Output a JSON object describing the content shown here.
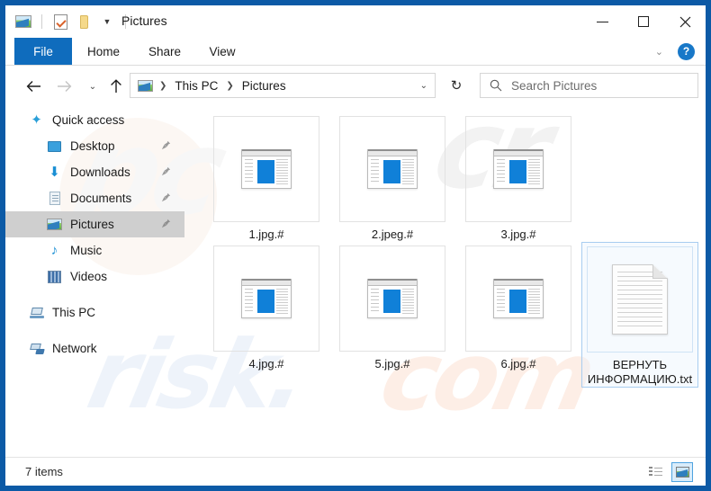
{
  "window": {
    "title": "Pictures",
    "quick_access_toolbar": [
      {
        "name": "picture-folder-icon",
        "label": "Pictures"
      },
      {
        "name": "properties-icon",
        "label": "Properties"
      },
      {
        "name": "new-folder-icon",
        "label": "New folder"
      },
      {
        "name": "customize-chevron-icon",
        "label": "Customize Quick Access Toolbar"
      }
    ],
    "controls": {
      "minimize": "Minimize",
      "maximize": "Maximize",
      "close": "Close"
    }
  },
  "ribbon": {
    "tabs": [
      {
        "label": "File",
        "active": true
      },
      {
        "label": "Home",
        "active": false
      },
      {
        "label": "Share",
        "active": false
      },
      {
        "label": "View",
        "active": false
      }
    ],
    "expand_label": "⌄",
    "help_label": "?"
  },
  "navigation": {
    "back": "←",
    "forward": "→",
    "recent": "⌄",
    "up": "↑",
    "refresh": "↻",
    "breadcrumb": [
      "This PC",
      "Pictures"
    ],
    "breadcrumb_separator": "❯",
    "address_chevron": "⌄"
  },
  "search": {
    "placeholder": "Search Pictures"
  },
  "sidebar": {
    "items": [
      {
        "label": "Quick access",
        "icon": "star-icon",
        "level": 0,
        "pinned": false,
        "selected": false
      },
      {
        "label": "Desktop",
        "icon": "desktop-icon",
        "level": 1,
        "pinned": true,
        "selected": false
      },
      {
        "label": "Downloads",
        "icon": "downloads-icon",
        "level": 1,
        "pinned": true,
        "selected": false
      },
      {
        "label": "Documents",
        "icon": "documents-icon",
        "level": 1,
        "pinned": true,
        "selected": false
      },
      {
        "label": "Pictures",
        "icon": "pictures-icon",
        "level": 1,
        "pinned": true,
        "selected": true
      },
      {
        "label": "Music",
        "icon": "music-icon",
        "level": 1,
        "pinned": false,
        "selected": false
      },
      {
        "label": "Videos",
        "icon": "videos-icon",
        "level": 1,
        "pinned": false,
        "selected": false
      },
      {
        "label": "This PC",
        "icon": "this-pc-icon",
        "level": 0,
        "pinned": false,
        "selected": false
      },
      {
        "label": "Network",
        "icon": "network-icon",
        "level": 0,
        "pinned": false,
        "selected": false
      }
    ],
    "pin_glyph": "📌"
  },
  "files": [
    {
      "name": "1.jpg.#",
      "icon": "generic-file-icon",
      "selected": false
    },
    {
      "name": "2.jpeg.#",
      "icon": "generic-file-icon",
      "selected": false
    },
    {
      "name": "3.jpg.#",
      "icon": "generic-file-icon",
      "selected": false
    },
    {
      "name": "4.jpg.#",
      "icon": "generic-file-icon",
      "selected": false
    },
    {
      "name": "5.jpg.#",
      "icon": "generic-file-icon",
      "selected": false
    },
    {
      "name": "6.jpg.#",
      "icon": "generic-file-icon",
      "selected": false
    },
    {
      "name": "ВЕРНУТЬ ИНФОРМАЦИЮ.txt",
      "icon": "text-file-icon",
      "selected": true
    }
  ],
  "status": {
    "item_count": "7 items",
    "views": [
      {
        "name": "details-view-button",
        "label": "Details view",
        "active": false
      },
      {
        "name": "large-icons-view-button",
        "label": "Large icons view",
        "active": true
      }
    ]
  },
  "watermark": {
    "line_a": "cr",
    "line_b": "pc",
    "line_c": "risk.",
    "line_d": "com"
  },
  "colors": {
    "window_border": "#0c5aa6",
    "file_tab": "#0f6cbd",
    "help_button": "#1878c8",
    "selection": "#cfcfcf",
    "file_selection_border": "#a8cdf0"
  }
}
